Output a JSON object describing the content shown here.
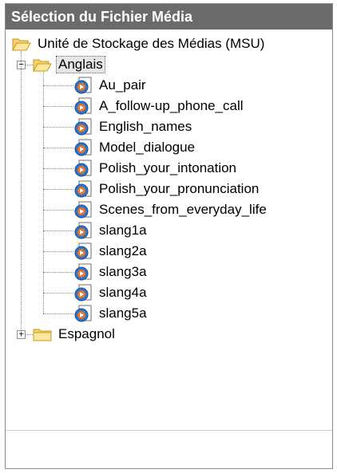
{
  "title": "Sélection du Fichier Média",
  "root": {
    "label": "Unité de Stockage des Médias (MSU)",
    "icon": "folder-open-icon"
  },
  "folders": [
    {
      "label": "Anglais",
      "icon": "folder-open-icon",
      "expanded": true,
      "selected": true,
      "files": [
        "Au_pair",
        "A_follow-up_phone_call",
        "English_names",
        "Model_dialogue",
        "Polish_your_intonation",
        "Polish_your_pronunciation",
        "Scenes_from_everyday_life",
        "slang1a",
        "slang2a",
        "slang3a",
        "slang4a",
        "slang5a"
      ]
    },
    {
      "label": "Espagnol",
      "icon": "folder-closed-icon",
      "expanded": false,
      "selected": false,
      "files": []
    }
  ],
  "file_icon": "media-file-icon",
  "expander_symbols": {
    "expanded": "−",
    "collapsed": "+"
  }
}
